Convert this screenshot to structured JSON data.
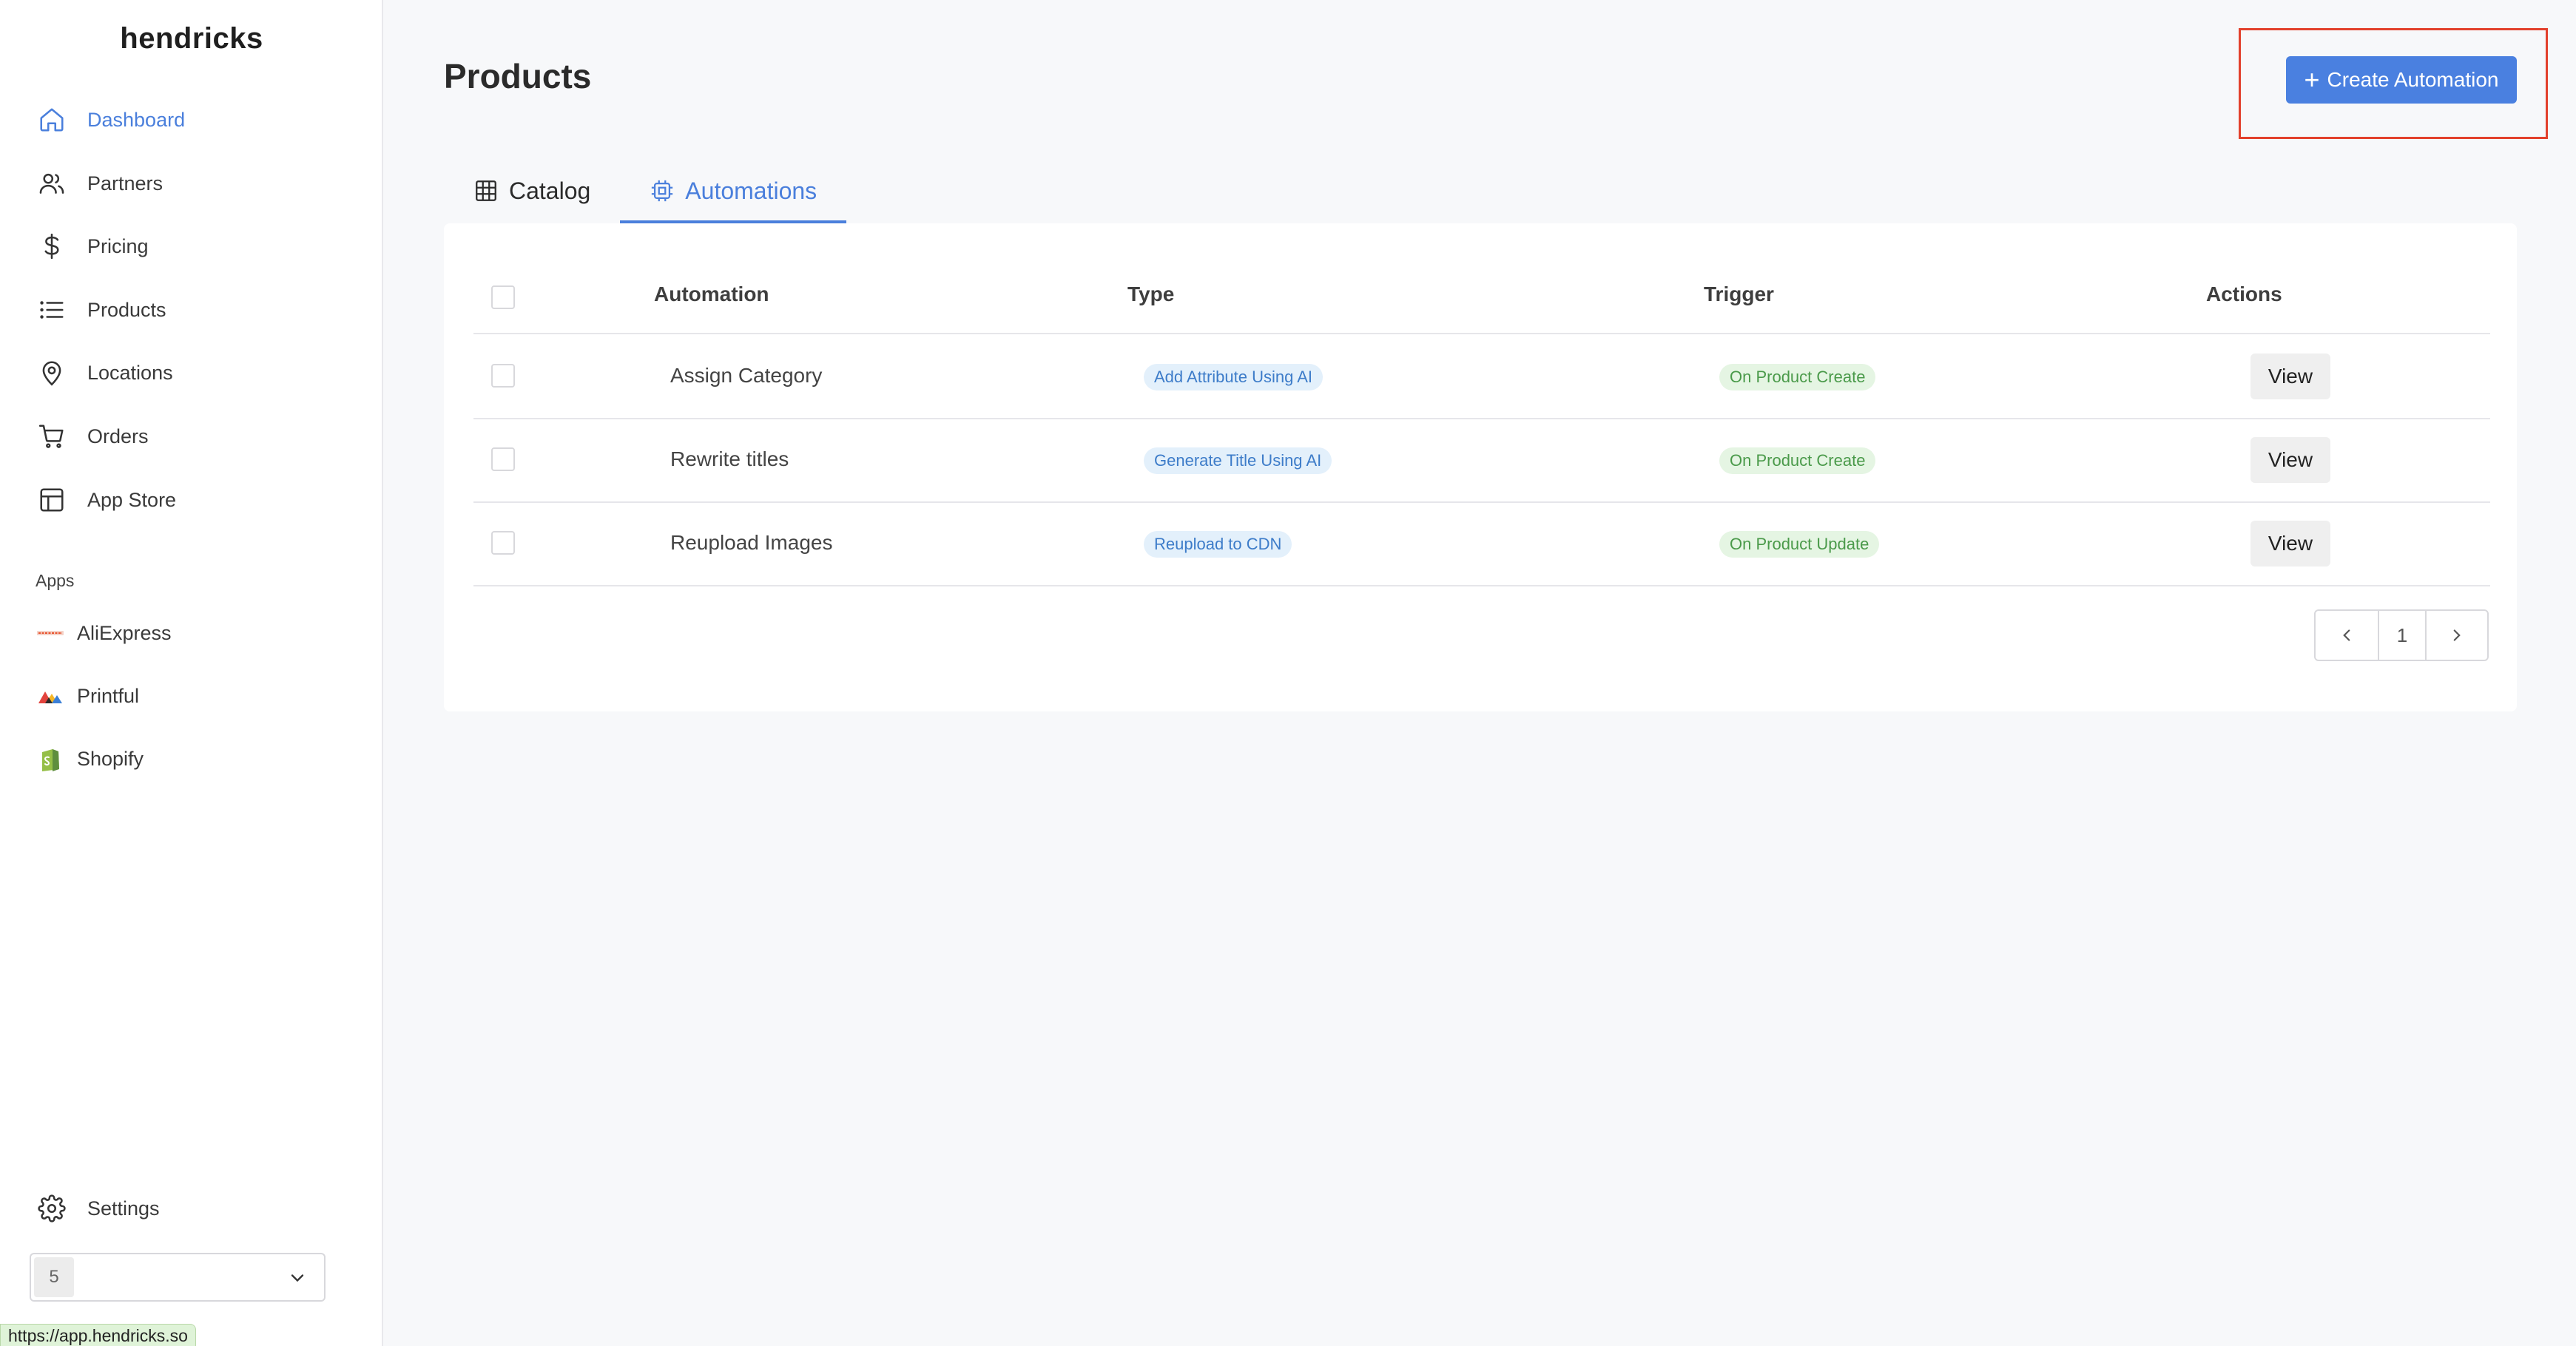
{
  "brand": "hendricks",
  "sidebar": {
    "items": [
      {
        "label": "Dashboard",
        "icon": "home-icon",
        "active": true
      },
      {
        "label": "Partners",
        "icon": "users-icon"
      },
      {
        "label": "Pricing",
        "icon": "dollar-icon"
      },
      {
        "label": "Products",
        "icon": "list-icon"
      },
      {
        "label": "Locations",
        "icon": "map-pin-icon"
      },
      {
        "label": "Orders",
        "icon": "cart-icon"
      },
      {
        "label": "App Store",
        "icon": "layout-icon"
      }
    ],
    "apps_label": "Apps",
    "apps": [
      {
        "label": "AliExpress",
        "icon": "aliexpress-logo-icon"
      },
      {
        "label": "Printful",
        "icon": "printful-logo-icon"
      },
      {
        "label": "Shopify",
        "icon": "shopify-logo-icon"
      }
    ],
    "settings_label": "Settings",
    "org_selector": {
      "badge": "5",
      "value": ""
    }
  },
  "page": {
    "title": "Products",
    "create_button": "Create Automation",
    "tabs": [
      {
        "label": "Catalog",
        "icon": "table-grid-icon"
      },
      {
        "label": "Automations",
        "icon": "cpu-icon",
        "active": true
      }
    ]
  },
  "table": {
    "columns": [
      "Automation",
      "Type",
      "Trigger",
      "Actions"
    ],
    "rows": [
      {
        "name": "Assign Category",
        "type": "Add Attribute Using AI",
        "trigger": "On Product Create",
        "action": "View"
      },
      {
        "name": "Rewrite titles",
        "type": "Generate Title Using AI",
        "trigger": "On Product Create",
        "action": "View"
      },
      {
        "name": "Reupload Images",
        "type": "Reupload to CDN",
        "trigger": "On Product Update",
        "action": "View"
      }
    ]
  },
  "pagination": {
    "current_page": "1"
  },
  "status_url": "https://app.hendricks.so",
  "colors": {
    "accent": "#4a80e0",
    "highlight_box": "#e2402c",
    "tag_blue_bg": "#e3f0fb",
    "tag_green_bg": "#e5f5e3"
  }
}
